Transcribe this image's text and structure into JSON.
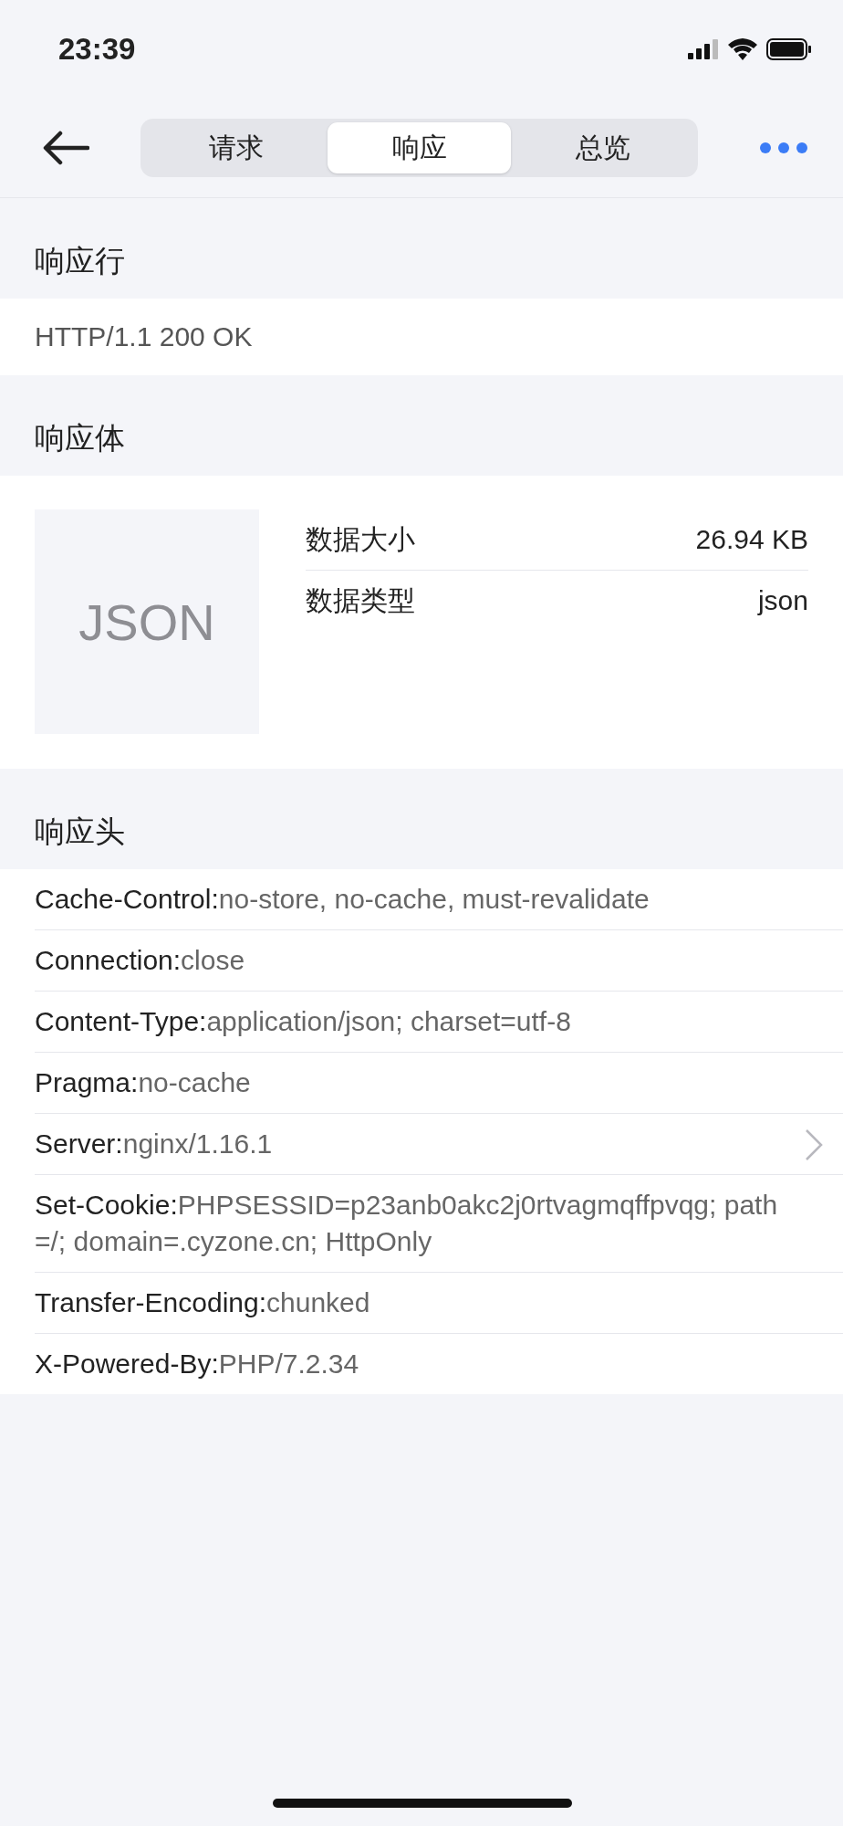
{
  "status_bar": {
    "time": "23:39"
  },
  "nav": {
    "tabs": [
      {
        "label": "请求",
        "selected": false
      },
      {
        "label": "响应",
        "selected": true
      },
      {
        "label": "总览",
        "selected": false
      }
    ]
  },
  "response_line": {
    "title": "响应行",
    "value": "HTTP/1.1 200 OK"
  },
  "response_body": {
    "title": "响应体",
    "preview": "JSON",
    "info": [
      {
        "label": "数据大小",
        "value": "26.94 KB"
      },
      {
        "label": "数据类型",
        "value": "json"
      }
    ]
  },
  "response_headers": {
    "title": "响应头",
    "rows": [
      {
        "name": "Cache-Control:",
        "value": "no-store, no-cache, must-revalidate",
        "chevron": false
      },
      {
        "name": "Connection:",
        "value": "close",
        "chevron": false
      },
      {
        "name": "Content-Type:",
        "value": "application/json; charset=utf-8",
        "chevron": false
      },
      {
        "name": "Pragma:",
        "value": "no-cache",
        "chevron": false
      },
      {
        "name": "Server:",
        "value": "nginx/1.16.1",
        "chevron": true
      },
      {
        "name": "Set-Cookie:",
        "value": "PHPSESSID=p23anb0akc2j0rtvagmqffpvqg; path=/; domain=.cyzone.cn; HttpOnly",
        "chevron": false
      },
      {
        "name": "Transfer-Encoding:",
        "value": "chunked",
        "chevron": false
      },
      {
        "name": "X-Powered-By:",
        "value": "PHP/7.2.34",
        "chevron": false
      }
    ]
  }
}
